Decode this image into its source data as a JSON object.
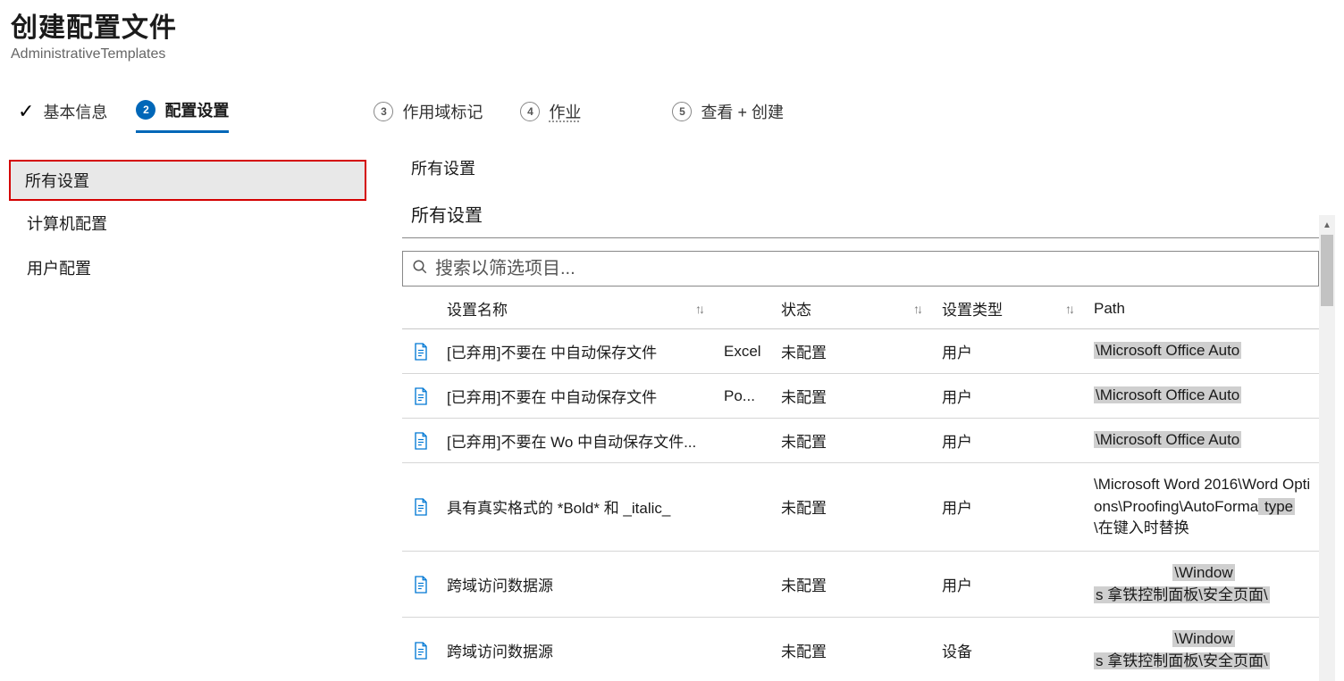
{
  "header": {
    "title": "创建配置文件",
    "subtitle": "AdministrativeTemplates"
  },
  "wizard": {
    "step1": "基本信息",
    "step2": "配置设置",
    "step3": "作用域标记",
    "step4": "作业",
    "step5": "查看 + 创建",
    "n2": "2",
    "n3": "3",
    "n4": "4",
    "n5": "5"
  },
  "tree": {
    "all": "所有设置",
    "computer": "计算机配置",
    "user": "用户配置"
  },
  "main": {
    "breadcrumb1": "所有设置",
    "breadcrumb2": "所有设置",
    "search_placeholder": "搜索以筛选项目..."
  },
  "columns": {
    "name": "设置名称",
    "state": "状态",
    "type": "设置类型",
    "path": "Path",
    "sort_glyph": "↑↓"
  },
  "rows": [
    {
      "name": "[已弃用]不要在 中自动保存文件",
      "state_a": "Excel",
      "state": "未配置",
      "type": "用户",
      "path_parts": [
        {
          "t": "\\Microsoft Office Auto",
          "hl": true
        }
      ]
    },
    {
      "name": "[已弃用]不要在 中自动保存文件",
      "state_a": "Po...",
      "state": "未配置",
      "type": "用户",
      "path_parts": [
        {
          "t": "\\Microsoft Office Auto",
          "hl": true
        }
      ]
    },
    {
      "name": "[已弃用]不要在 Wo 中自动保存文件...",
      "state_a": "",
      "state": "未配置",
      "type": "用户",
      "path_parts": [
        {
          "t": "\\Microsoft Office Auto",
          "hl": true
        }
      ]
    },
    {
      "name": "具有真实格式的 *Bold* 和 _italic_",
      "state_a": "",
      "state": "未配置",
      "type": "用户",
      "path_parts": [
        {
          "t": "\\Microsoft Word 2016\\Word Options\\Proofing\\AutoForma",
          "hl": false
        },
        {
          "t": " type",
          "hl": true
        },
        {
          "t": "\\在键入时替换",
          "hl": false
        }
      ]
    },
    {
      "name": "跨域访问数据源",
      "state_a": "",
      "state": "未配置",
      "type": "用户",
      "path_parts": [
        {
          "t": "\\Window",
          "hl": true
        },
        {
          "t": "s 拿铁控制面板\\安全页面\\",
          "hl": true
        }
      ]
    },
    {
      "name": "跨域访问数据源",
      "state_a": "",
      "state": "未配置",
      "type": "设备",
      "path_parts": [
        {
          "t": "\\Window",
          "hl": true
        },
        {
          "t": "s 拿铁控制面板\\安全页面\\",
          "hl": true
        }
      ]
    }
  ]
}
